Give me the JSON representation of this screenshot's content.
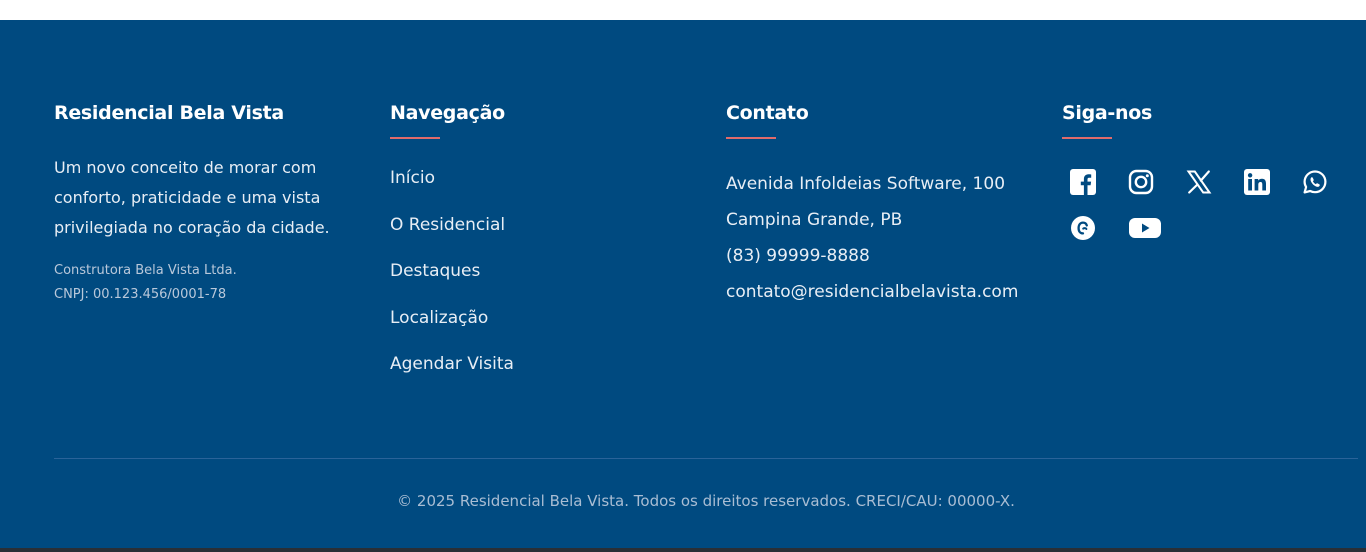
{
  "brand": {
    "title": "Residencial Bela Vista",
    "description": "Um novo conceito de morar com conforto, praticidade e uma vista privilegiada no coração da cidade.",
    "company": "Construtora Bela Vista Ltda.",
    "cnpj": "CNPJ: 00.123.456/0001-78"
  },
  "navigation": {
    "title": "Navegação",
    "items": [
      "Início",
      "O Residencial",
      "Destaques",
      "Localização",
      "Agendar Visita"
    ]
  },
  "contact": {
    "title": "Contato",
    "address_line1": "Avenida Infoldeias Software, 100",
    "address_line2": "Campina Grande, PB",
    "phone": "(83) 99999-8888",
    "email": "contato@residencialbelavista.com"
  },
  "social": {
    "title": "Siga-nos",
    "icons": [
      "facebook-icon",
      "instagram-icon",
      "x-icon",
      "linkedin-icon",
      "whatsapp-icon",
      "threads-icon",
      "youtube-icon"
    ]
  },
  "footer": {
    "copyright": "© 2025 Residencial Bela Vista. Todos os direitos reservados. CRECI/CAU: 00000-X."
  },
  "colors": {
    "background": "#004a80",
    "accent_underline": "#e06b6b",
    "text": "#ffffff"
  }
}
